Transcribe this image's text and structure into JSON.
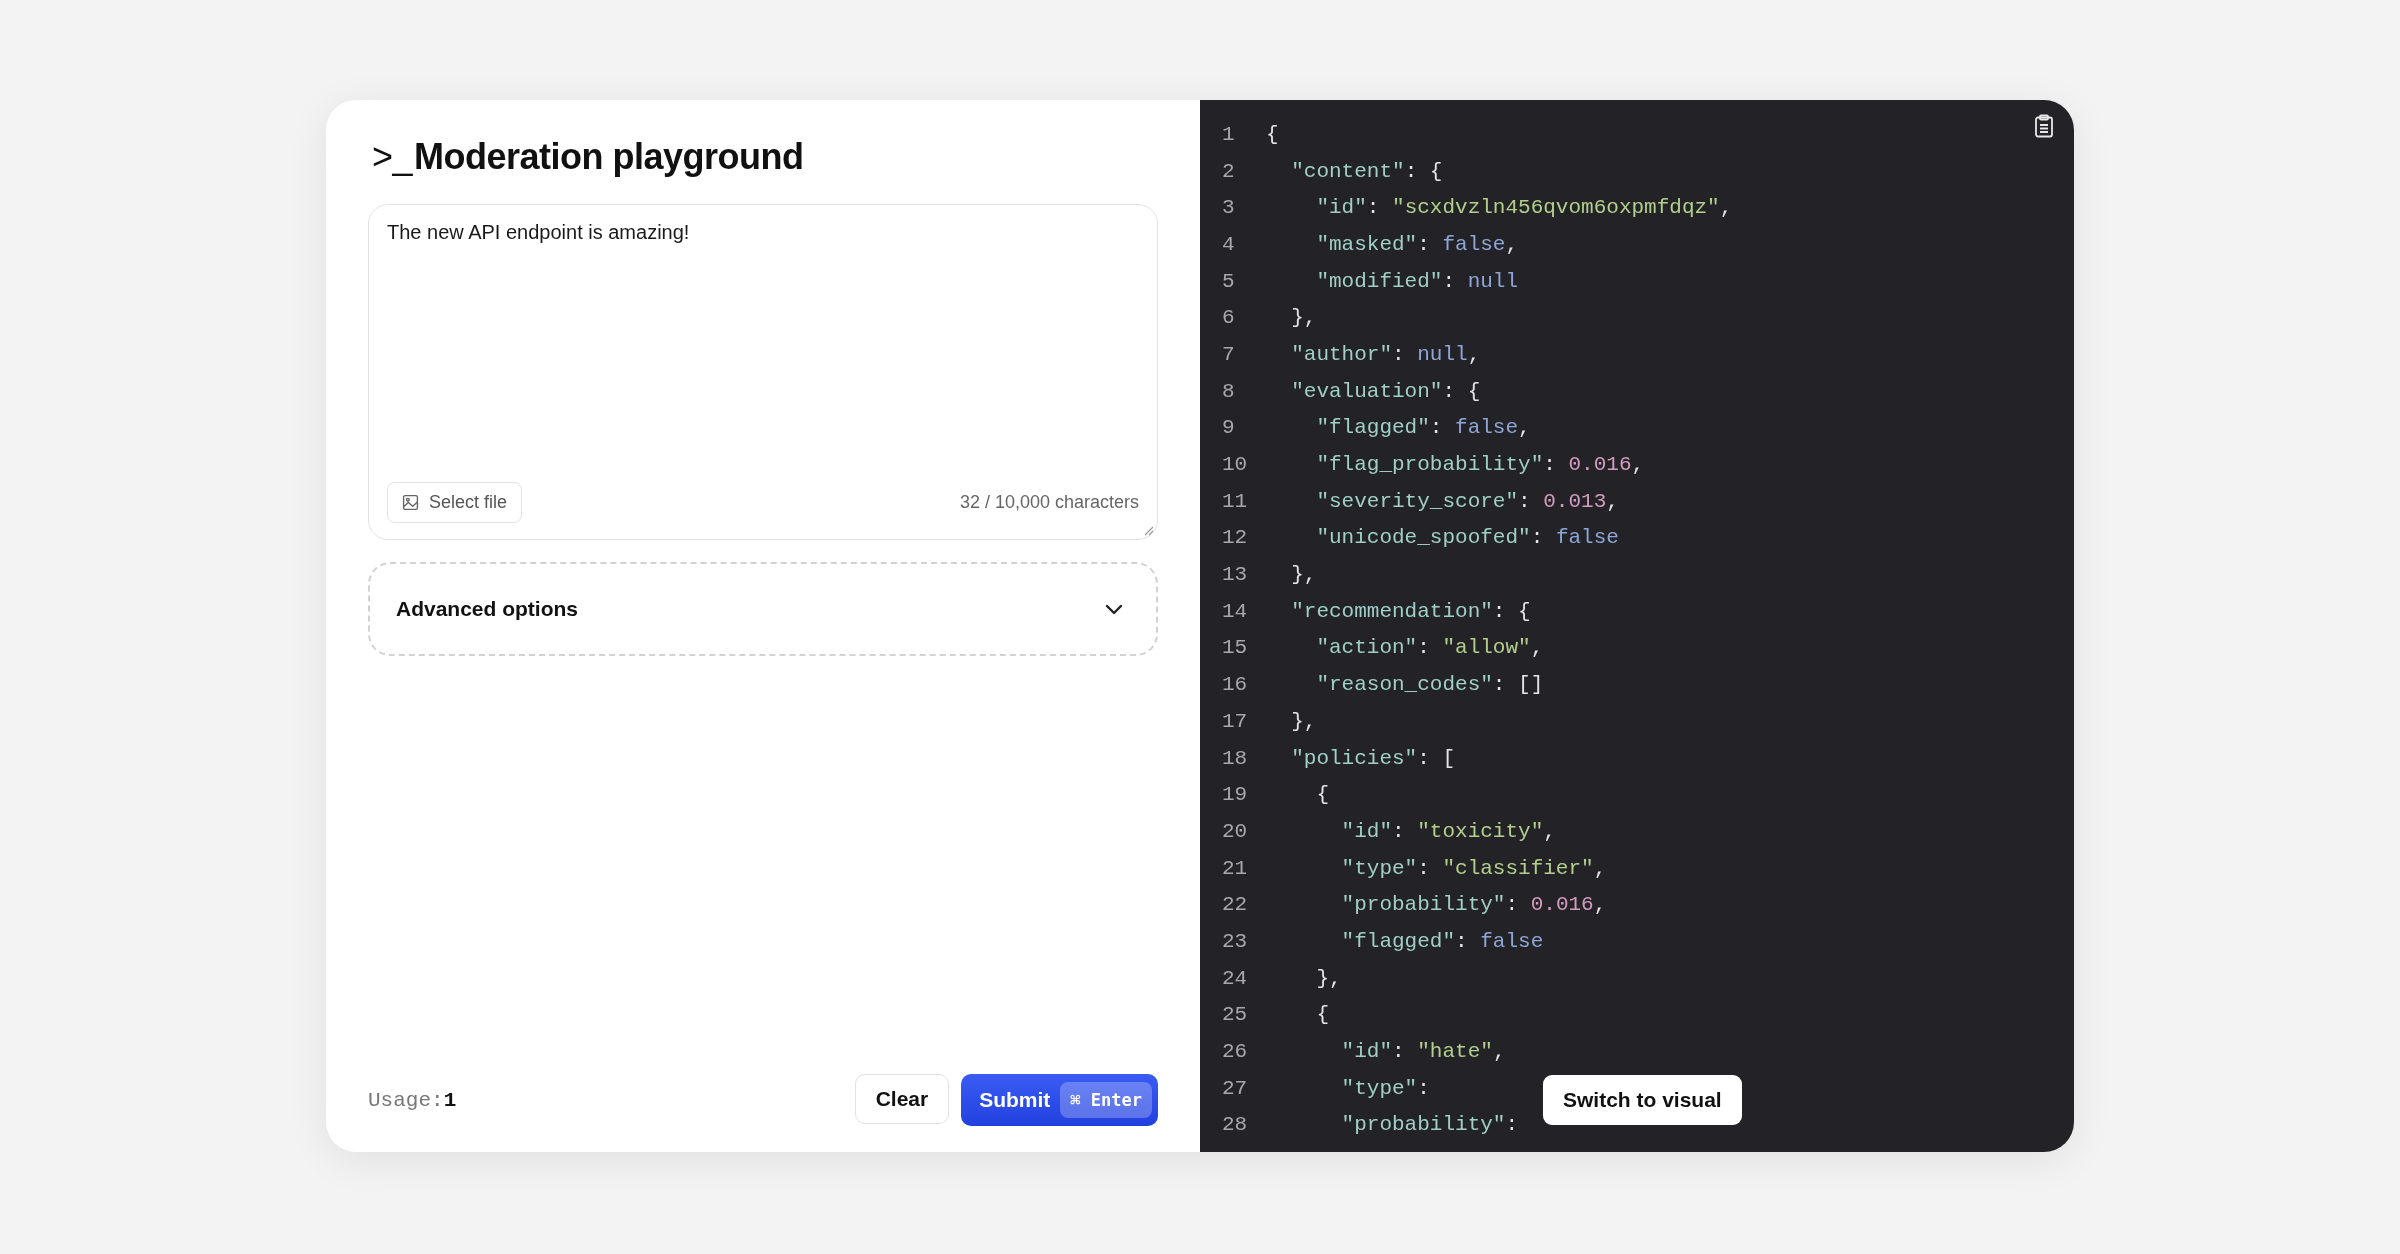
{
  "title": {
    "prompt": ">_",
    "text": "Moderation playground"
  },
  "input": {
    "value": "The new API endpoint is amazing!",
    "select_file": "Select file",
    "counter": "32 / 10,000 characters"
  },
  "advanced": {
    "label": "Advanced options",
    "expanded": false
  },
  "footer": {
    "usage_label": "Usage:",
    "usage_value": "1",
    "clear": "Clear",
    "submit": "Submit",
    "shortcut": "⌘ Enter"
  },
  "code": {
    "switch_button": "Switch to visual",
    "lines": [
      {
        "n": "1",
        "tokens": [
          {
            "kind": "punct",
            "text": "{"
          }
        ]
      },
      {
        "n": "2",
        "tokens": [
          {
            "kind": "key",
            "text": "  \"content\""
          },
          {
            "kind": "punct",
            "text": ": {"
          }
        ]
      },
      {
        "n": "3",
        "tokens": [
          {
            "kind": "key",
            "text": "    \"id\""
          },
          {
            "kind": "punct",
            "text": ": "
          },
          {
            "kind": "str",
            "text": "\"scxdvzln456qvom6oxpmfdqz\""
          },
          {
            "kind": "punct",
            "text": ","
          }
        ]
      },
      {
        "n": "4",
        "tokens": [
          {
            "kind": "key",
            "text": "    \"masked\""
          },
          {
            "kind": "punct",
            "text": ": "
          },
          {
            "kind": "kw",
            "text": "false"
          },
          {
            "kind": "punct",
            "text": ","
          }
        ]
      },
      {
        "n": "5",
        "tokens": [
          {
            "kind": "key",
            "text": "    \"modified\""
          },
          {
            "kind": "punct",
            "text": ": "
          },
          {
            "kind": "kw",
            "text": "null"
          }
        ]
      },
      {
        "n": "6",
        "tokens": [
          {
            "kind": "punct",
            "text": "  },"
          }
        ]
      },
      {
        "n": "7",
        "tokens": [
          {
            "kind": "key",
            "text": "  \"author\""
          },
          {
            "kind": "punct",
            "text": ": "
          },
          {
            "kind": "kw",
            "text": "null"
          },
          {
            "kind": "punct",
            "text": ","
          }
        ]
      },
      {
        "n": "8",
        "tokens": [
          {
            "kind": "key",
            "text": "  \"evaluation\""
          },
          {
            "kind": "punct",
            "text": ": {"
          }
        ]
      },
      {
        "n": "9",
        "tokens": [
          {
            "kind": "key",
            "text": "    \"flagged\""
          },
          {
            "kind": "punct",
            "text": ": "
          },
          {
            "kind": "kw",
            "text": "false"
          },
          {
            "kind": "punct",
            "text": ","
          }
        ]
      },
      {
        "n": "10",
        "tokens": [
          {
            "kind": "key",
            "text": "    \"flag_probability\""
          },
          {
            "kind": "punct",
            "text": ": "
          },
          {
            "kind": "num",
            "text": "0.016"
          },
          {
            "kind": "punct",
            "text": ","
          }
        ]
      },
      {
        "n": "11",
        "tokens": [
          {
            "kind": "key",
            "text": "    \"severity_score\""
          },
          {
            "kind": "punct",
            "text": ": "
          },
          {
            "kind": "num",
            "text": "0.013"
          },
          {
            "kind": "punct",
            "text": ","
          }
        ]
      },
      {
        "n": "12",
        "tokens": [
          {
            "kind": "key",
            "text": "    \"unicode_spoofed\""
          },
          {
            "kind": "punct",
            "text": ": "
          },
          {
            "kind": "kw",
            "text": "false"
          }
        ]
      },
      {
        "n": "13",
        "tokens": [
          {
            "kind": "punct",
            "text": "  },"
          }
        ]
      },
      {
        "n": "14",
        "tokens": [
          {
            "kind": "key",
            "text": "  \"recommendation\""
          },
          {
            "kind": "punct",
            "text": ": {"
          }
        ]
      },
      {
        "n": "15",
        "tokens": [
          {
            "kind": "key",
            "text": "    \"action\""
          },
          {
            "kind": "punct",
            "text": ": "
          },
          {
            "kind": "str",
            "text": "\"allow\""
          },
          {
            "kind": "punct",
            "text": ","
          }
        ]
      },
      {
        "n": "16",
        "tokens": [
          {
            "kind": "key",
            "text": "    \"reason_codes\""
          },
          {
            "kind": "punct",
            "text": ": []"
          }
        ]
      },
      {
        "n": "17",
        "tokens": [
          {
            "kind": "punct",
            "text": "  },"
          }
        ]
      },
      {
        "n": "18",
        "tokens": [
          {
            "kind": "key",
            "text": "  \"policies\""
          },
          {
            "kind": "punct",
            "text": ": ["
          }
        ]
      },
      {
        "n": "19",
        "tokens": [
          {
            "kind": "punct",
            "text": "    {"
          }
        ]
      },
      {
        "n": "20",
        "tokens": [
          {
            "kind": "key",
            "text": "      \"id\""
          },
          {
            "kind": "punct",
            "text": ": "
          },
          {
            "kind": "str",
            "text": "\"toxicity\""
          },
          {
            "kind": "punct",
            "text": ","
          }
        ]
      },
      {
        "n": "21",
        "tokens": [
          {
            "kind": "key",
            "text": "      \"type\""
          },
          {
            "kind": "punct",
            "text": ": "
          },
          {
            "kind": "str",
            "text": "\"classifier\""
          },
          {
            "kind": "punct",
            "text": ","
          }
        ]
      },
      {
        "n": "22",
        "tokens": [
          {
            "kind": "key",
            "text": "      \"probability\""
          },
          {
            "kind": "punct",
            "text": ": "
          },
          {
            "kind": "num",
            "text": "0.016"
          },
          {
            "kind": "punct",
            "text": ","
          }
        ]
      },
      {
        "n": "23",
        "tokens": [
          {
            "kind": "key",
            "text": "      \"flagged\""
          },
          {
            "kind": "punct",
            "text": ": "
          },
          {
            "kind": "kw",
            "text": "false"
          }
        ]
      },
      {
        "n": "24",
        "tokens": [
          {
            "kind": "punct",
            "text": "    },"
          }
        ]
      },
      {
        "n": "25",
        "tokens": [
          {
            "kind": "punct",
            "text": "    {"
          }
        ]
      },
      {
        "n": "26",
        "tokens": [
          {
            "kind": "key",
            "text": "      \"id\""
          },
          {
            "kind": "punct",
            "text": ": "
          },
          {
            "kind": "str",
            "text": "\"hate\""
          },
          {
            "kind": "punct",
            "text": ","
          }
        ]
      },
      {
        "n": "27",
        "tokens": [
          {
            "kind": "key",
            "text": "      \"type\""
          },
          {
            "kind": "punct",
            "text": ": "
          }
        ]
      },
      {
        "n": "28",
        "tokens": [
          {
            "kind": "key",
            "text": "      \"probability\""
          },
          {
            "kind": "punct",
            "text": ": "
          }
        ]
      }
    ]
  }
}
